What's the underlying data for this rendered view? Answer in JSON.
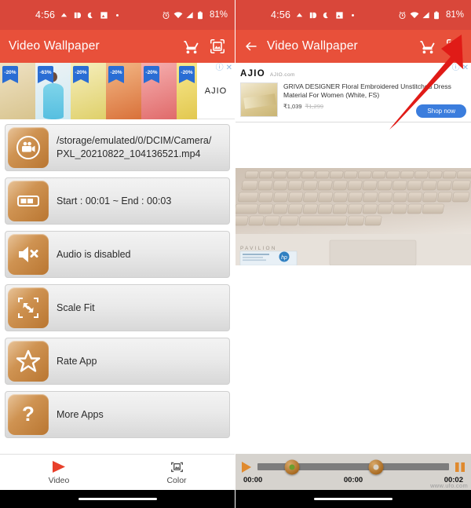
{
  "meta": {
    "accent_red": "#E8503A",
    "status_red": "#D9473A",
    "icon_orange": "#B97631",
    "ad_blue": "#3b7ddd"
  },
  "status_bar": {
    "time": "4:56",
    "battery_percent": "81%",
    "left_icons": [
      "notification-icon",
      "notification-icon",
      "moon-icon",
      "image-icon",
      "dot-icon"
    ],
    "right_icons": [
      "alarm-icon",
      "wifi-icon",
      "signal-icon",
      "battery-icon"
    ]
  },
  "left_screen": {
    "appbar": {
      "title": "Video Wallpaper",
      "cart_icon": "cart-icon",
      "wallpaper_icon": "set-wallpaper-icon"
    },
    "ad": {
      "brand": "AJIO",
      "info_icon": "ad-info-icon",
      "close_icon": "ad-close-icon",
      "thumbs": [
        {
          "discount": "-20%",
          "c1": "#efe2c4",
          "c2": "#d8c48e"
        },
        {
          "discount": "-63%",
          "c1": "#bfe6f2",
          "c2": "#6ec7e0"
        },
        {
          "discount": "-20%",
          "c1": "#f3e9b8",
          "c2": "#d9cf6a"
        },
        {
          "discount": "-20%",
          "c1": "#f0b07a",
          "c2": "#d9713a"
        },
        {
          "discount": "-20%",
          "c1": "#f3a6a6",
          "c2": "#e06a6a"
        },
        {
          "discount": "-20%",
          "c1": "#f6e58a",
          "c2": "#e0c54a"
        }
      ]
    },
    "rows": [
      {
        "icon": "video-file-icon",
        "label": "/storage/emulated/0/DCIM/Camera/\nPXL_20210822_104136521.mp4"
      },
      {
        "icon": "trim-range-icon",
        "label": "Start : 00:01 ~ End : 00:03"
      },
      {
        "icon": "audio-muted-icon",
        "label": "Audio is disabled"
      },
      {
        "icon": "scale-fit-icon",
        "label": "Scale Fit"
      },
      {
        "icon": "star-icon",
        "label": "Rate App"
      },
      {
        "icon": "question-icon",
        "label": "More Apps"
      }
    ],
    "bottom_nav": [
      {
        "icon": "play-icon",
        "label": "Video",
        "selected": true
      },
      {
        "icon": "color-picker-icon",
        "label": "Color",
        "selected": false
      }
    ]
  },
  "right_screen": {
    "appbar": {
      "back_icon": "back-arrow-icon",
      "title": "Video Wallpaper",
      "cart_icon": "cart-icon",
      "wallpaper_icon": "set-wallpaper-icon"
    },
    "ad": {
      "brand": "AJIO",
      "url": "AJIO.com",
      "title": "GRIVA DESIGNER Floral Embroidered Unstitched Dress Material For Women (White, FS)",
      "price": "₹1,039",
      "old_price": "₹1,299",
      "cta": "Shop now",
      "info_icon": "ad-info-icon",
      "close_icon": "ad-close-icon"
    },
    "preview": {
      "alt": "laptop-keyboard-video-preview"
    },
    "player": {
      "play_icon": "play-icon",
      "pause_icon": "pause-icon",
      "start_time": "00:00",
      "current_time": "00:00",
      "end_time": "00:02",
      "thumb_start_pct": 18,
      "thumb_end_pct": 62
    },
    "watermark": "www.ufo.com"
  },
  "annotation": {
    "arrow_icon": "red-pointer-arrow",
    "color": "#E01B17"
  }
}
